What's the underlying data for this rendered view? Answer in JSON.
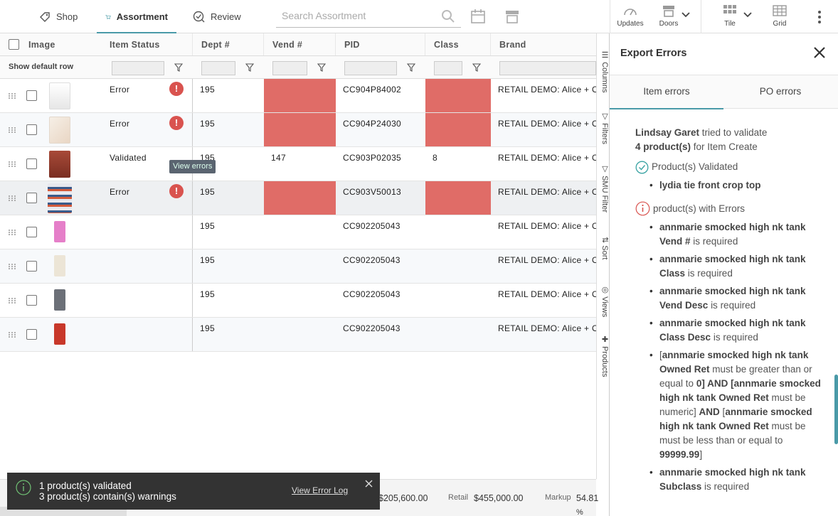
{
  "nav": {
    "tabs": [
      {
        "label": "Shop",
        "icon": "tag-icon"
      },
      {
        "label": "Assortment",
        "icon": "cart-icon"
      },
      {
        "label": "Review",
        "icon": "review-check-icon"
      }
    ],
    "search_placeholder": "Search Assortment"
  },
  "toolbar": {
    "updates": "Updates",
    "doors": "Doors",
    "tile": "Tile",
    "grid": "Grid"
  },
  "grid": {
    "columns": [
      "Image",
      "Item Status",
      "Dept #",
      "Vend #",
      "PID",
      "Class",
      "Brand"
    ],
    "filter_row_label": "Show default row",
    "tooltip": "View errors",
    "rows": [
      {
        "status": "Error",
        "dept": "195",
        "vend": "",
        "pid": "CC904P84002",
        "class": "",
        "brand": "RETAIL DEMO: Alice + Olivia",
        "error": true
      },
      {
        "status": "Error",
        "dept": "195",
        "vend": "",
        "pid": "CC904P24030",
        "class": "",
        "brand": "RETAIL DEMO: Alice + Olivia",
        "error": true
      },
      {
        "status": "Validated",
        "dept": "195",
        "vend": "147",
        "pid": "CC903P02035",
        "class": "8",
        "brand": "RETAIL DEMO: Alice + Olivia",
        "error": false
      },
      {
        "status": "Error",
        "dept": "195",
        "vend": "",
        "pid": "CC903V50013",
        "class": "",
        "brand": "RETAIL DEMO: Alice + Olivia",
        "error": true
      },
      {
        "status": "",
        "dept": "195",
        "vend": "",
        "pid": "CC902205043",
        "class": "",
        "brand": "RETAIL DEMO: Alice + Olivia",
        "error": false
      },
      {
        "status": "",
        "dept": "195",
        "vend": "",
        "pid": "CC902205043",
        "class": "",
        "brand": "RETAIL DEMO: Alice + Olivia",
        "error": false
      },
      {
        "status": "",
        "dept": "195",
        "vend": "",
        "pid": "CC902205043",
        "class": "",
        "brand": "RETAIL DEMO: Alice + Olivia",
        "error": false
      },
      {
        "status": "",
        "dept": "195",
        "vend": "",
        "pid": "CC902205043",
        "class": "",
        "brand": "RETAIL DEMO: Alice + Olivia",
        "error": false
      }
    ]
  },
  "side_tabs": [
    "Columns",
    "Filters",
    "SMU Filter",
    "Sort",
    "Views",
    "Products"
  ],
  "panel": {
    "title": "Export Errors",
    "tabs": [
      "Item errors",
      "PO errors"
    ],
    "user": "Lindsay Garet",
    "intro_a": "tried to validate",
    "count": "4 product(s)",
    "intro_b": "for Item Create",
    "validated_heading": "Product(s) Validated",
    "validated_items": [
      "lydia tie front crop top"
    ],
    "errors_heading": "product(s) with Errors",
    "e1_name": "annmarie smocked high nk tank",
    "e1_field": "Vend #",
    "e1_msg": "is required",
    "e2_name": "annmarie smocked high nk tank",
    "e2_field": "Class",
    "e2_msg": "is required",
    "e3_name": "annmarie smocked high nk tank",
    "e3_field": "Vend Desc",
    "e3_msg": "is required",
    "e4_name": "annmarie smocked high nk tank",
    "e4_field": "Class Desc",
    "e4_msg": "is required",
    "e5_open": "[",
    "e5_a": "annmarie smocked high nk tank Owned Ret",
    "e5_b": "must be greater than or equal to",
    "e5_c": "0",
    "e5_d": "] AND [",
    "e5_e": "annmarie smocked high nk tank Owned Ret",
    "e5_f": "must be numeric]",
    "e5_g": "AND",
    "e5_h": "[",
    "e5_i": "annmarie smocked high nk tank Owned Ret",
    "e5_j": "must be must be less than or equal to",
    "e5_k": "99999.99",
    "e5_l": "]",
    "e6_name": "annmarie smocked high nk tank",
    "e6_field": "Subclass",
    "e6_msg": "is required"
  },
  "toast": {
    "line1": "1 product(s) validated",
    "line2": "3 product(s) contain(s) warnings",
    "link": "View Error Log"
  },
  "footer": {
    "cost_value": "$205,600.00",
    "retail_label": "Retail",
    "retail_value": "$455,000.00",
    "markup_label": "Markup",
    "markup_value": "54.81",
    "markup_unit": "%"
  },
  "colors": {
    "accent": "#4a9aa8",
    "error_cell": "#e06c67",
    "error_badge": "#d9534f",
    "validated": "#3aa3a3"
  }
}
